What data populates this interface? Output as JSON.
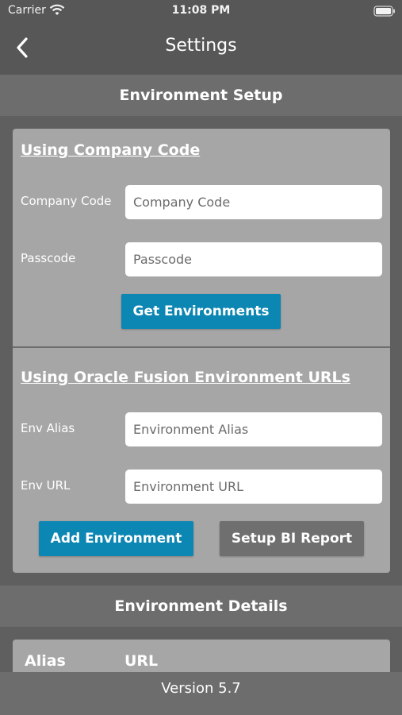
{
  "status_bar": {
    "carrier": "Carrier",
    "time": "11:08 PM"
  },
  "nav": {
    "title": "Settings",
    "back_icon": "chevron-left-icon"
  },
  "environment_setup": {
    "header": "Environment Setup",
    "company_code_section": {
      "title": "Using Company Code",
      "company_code_label": "Company Code",
      "company_code_placeholder": "Company Code",
      "company_code_value": "",
      "passcode_label": "Passcode",
      "passcode_placeholder": "Passcode",
      "passcode_value": "",
      "get_environments_label": "Get Environments"
    },
    "url_section": {
      "title": "Using Oracle Fusion Environment URLs",
      "env_alias_label": "Env Alias",
      "env_alias_placeholder": "Environment Alias",
      "env_alias_value": "",
      "env_url_label": "Env URL",
      "env_url_placeholder": "Environment URL",
      "env_url_value": "",
      "add_environment_label": "Add Environment",
      "setup_bi_report_label": "Setup BI Report"
    }
  },
  "environment_details": {
    "header": "Environment Details",
    "columns": [
      "Alias",
      "URL"
    ]
  },
  "footer": {
    "version": "Version 5.7"
  },
  "colors": {
    "primary_button": "#0c86b2",
    "secondary_button": "#6f6f6f",
    "card_background": "#a6a6a6",
    "page_background": "#5f5f5f"
  }
}
